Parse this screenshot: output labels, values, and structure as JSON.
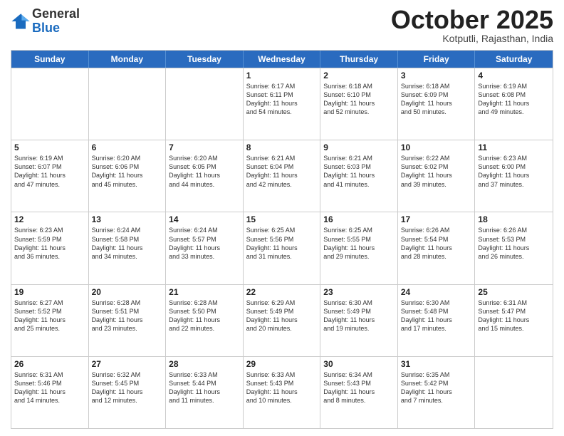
{
  "logo": {
    "general": "General",
    "blue": "Blue"
  },
  "header": {
    "month": "October 2025",
    "location": "Kotputli, Rajasthan, India"
  },
  "days": [
    "Sunday",
    "Monday",
    "Tuesday",
    "Wednesday",
    "Thursday",
    "Friday",
    "Saturday"
  ],
  "rows": [
    [
      {
        "day": "",
        "info": ""
      },
      {
        "day": "",
        "info": ""
      },
      {
        "day": "",
        "info": ""
      },
      {
        "day": "1",
        "info": "Sunrise: 6:17 AM\nSunset: 6:11 PM\nDaylight: 11 hours\nand 54 minutes."
      },
      {
        "day": "2",
        "info": "Sunrise: 6:18 AM\nSunset: 6:10 PM\nDaylight: 11 hours\nand 52 minutes."
      },
      {
        "day": "3",
        "info": "Sunrise: 6:18 AM\nSunset: 6:09 PM\nDaylight: 11 hours\nand 50 minutes."
      },
      {
        "day": "4",
        "info": "Sunrise: 6:19 AM\nSunset: 6:08 PM\nDaylight: 11 hours\nand 49 minutes."
      }
    ],
    [
      {
        "day": "5",
        "info": "Sunrise: 6:19 AM\nSunset: 6:07 PM\nDaylight: 11 hours\nand 47 minutes."
      },
      {
        "day": "6",
        "info": "Sunrise: 6:20 AM\nSunset: 6:06 PM\nDaylight: 11 hours\nand 45 minutes."
      },
      {
        "day": "7",
        "info": "Sunrise: 6:20 AM\nSunset: 6:05 PM\nDaylight: 11 hours\nand 44 minutes."
      },
      {
        "day": "8",
        "info": "Sunrise: 6:21 AM\nSunset: 6:04 PM\nDaylight: 11 hours\nand 42 minutes."
      },
      {
        "day": "9",
        "info": "Sunrise: 6:21 AM\nSunset: 6:03 PM\nDaylight: 11 hours\nand 41 minutes."
      },
      {
        "day": "10",
        "info": "Sunrise: 6:22 AM\nSunset: 6:02 PM\nDaylight: 11 hours\nand 39 minutes."
      },
      {
        "day": "11",
        "info": "Sunrise: 6:23 AM\nSunset: 6:00 PM\nDaylight: 11 hours\nand 37 minutes."
      }
    ],
    [
      {
        "day": "12",
        "info": "Sunrise: 6:23 AM\nSunset: 5:59 PM\nDaylight: 11 hours\nand 36 minutes."
      },
      {
        "day": "13",
        "info": "Sunrise: 6:24 AM\nSunset: 5:58 PM\nDaylight: 11 hours\nand 34 minutes."
      },
      {
        "day": "14",
        "info": "Sunrise: 6:24 AM\nSunset: 5:57 PM\nDaylight: 11 hours\nand 33 minutes."
      },
      {
        "day": "15",
        "info": "Sunrise: 6:25 AM\nSunset: 5:56 PM\nDaylight: 11 hours\nand 31 minutes."
      },
      {
        "day": "16",
        "info": "Sunrise: 6:25 AM\nSunset: 5:55 PM\nDaylight: 11 hours\nand 29 minutes."
      },
      {
        "day": "17",
        "info": "Sunrise: 6:26 AM\nSunset: 5:54 PM\nDaylight: 11 hours\nand 28 minutes."
      },
      {
        "day": "18",
        "info": "Sunrise: 6:26 AM\nSunset: 5:53 PM\nDaylight: 11 hours\nand 26 minutes."
      }
    ],
    [
      {
        "day": "19",
        "info": "Sunrise: 6:27 AM\nSunset: 5:52 PM\nDaylight: 11 hours\nand 25 minutes."
      },
      {
        "day": "20",
        "info": "Sunrise: 6:28 AM\nSunset: 5:51 PM\nDaylight: 11 hours\nand 23 minutes."
      },
      {
        "day": "21",
        "info": "Sunrise: 6:28 AM\nSunset: 5:50 PM\nDaylight: 11 hours\nand 22 minutes."
      },
      {
        "day": "22",
        "info": "Sunrise: 6:29 AM\nSunset: 5:49 PM\nDaylight: 11 hours\nand 20 minutes."
      },
      {
        "day": "23",
        "info": "Sunrise: 6:30 AM\nSunset: 5:49 PM\nDaylight: 11 hours\nand 19 minutes."
      },
      {
        "day": "24",
        "info": "Sunrise: 6:30 AM\nSunset: 5:48 PM\nDaylight: 11 hours\nand 17 minutes."
      },
      {
        "day": "25",
        "info": "Sunrise: 6:31 AM\nSunset: 5:47 PM\nDaylight: 11 hours\nand 15 minutes."
      }
    ],
    [
      {
        "day": "26",
        "info": "Sunrise: 6:31 AM\nSunset: 5:46 PM\nDaylight: 11 hours\nand 14 minutes."
      },
      {
        "day": "27",
        "info": "Sunrise: 6:32 AM\nSunset: 5:45 PM\nDaylight: 11 hours\nand 12 minutes."
      },
      {
        "day": "28",
        "info": "Sunrise: 6:33 AM\nSunset: 5:44 PM\nDaylight: 11 hours\nand 11 minutes."
      },
      {
        "day": "29",
        "info": "Sunrise: 6:33 AM\nSunset: 5:43 PM\nDaylight: 11 hours\nand 10 minutes."
      },
      {
        "day": "30",
        "info": "Sunrise: 6:34 AM\nSunset: 5:43 PM\nDaylight: 11 hours\nand 8 minutes."
      },
      {
        "day": "31",
        "info": "Sunrise: 6:35 AM\nSunset: 5:42 PM\nDaylight: 11 hours\nand 7 minutes."
      },
      {
        "day": "",
        "info": ""
      }
    ]
  ]
}
